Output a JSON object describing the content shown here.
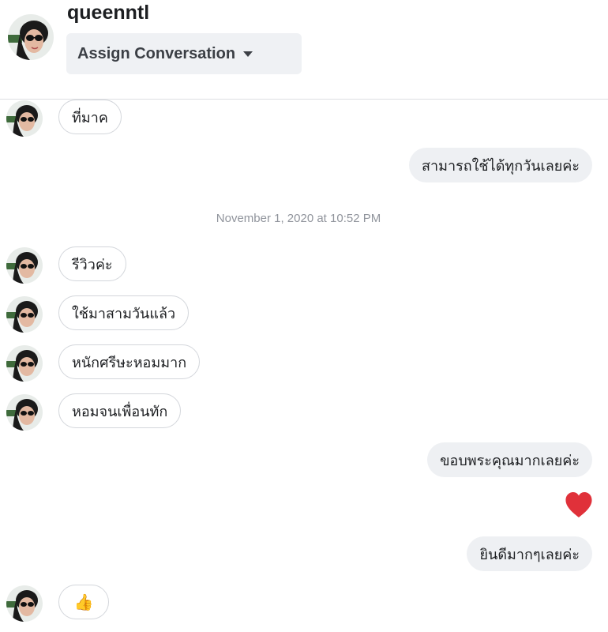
{
  "header": {
    "contact_name": "queenntl",
    "assign_button_label": "Assign Conversation"
  },
  "messages": [
    {
      "type": "incoming",
      "text": "ที่มาค"
    },
    {
      "type": "outgoing",
      "text": "สามารถใช้ได้ทุกวันเลยค่ะ"
    },
    {
      "type": "timestamp",
      "text": "November 1, 2020 at 10:52 PM"
    },
    {
      "type": "incoming",
      "text": "รีวิวค่ะ"
    },
    {
      "type": "incoming",
      "text": "ใช้มาสามวันแล้ว"
    },
    {
      "type": "incoming",
      "text": "หนักศรีษะหอมมาก"
    },
    {
      "type": "incoming",
      "text": "หอมจนเพื่อนทัก"
    },
    {
      "type": "outgoing",
      "text": "ขอบพระคุณมากเลยค่ะ"
    },
    {
      "type": "reaction",
      "icon": "heart-icon",
      "color": "#e0313a"
    },
    {
      "type": "outgoing",
      "text": "ยินดีมากๆเลยค่ะ"
    },
    {
      "type": "incoming",
      "emoji": "👍"
    }
  ]
}
